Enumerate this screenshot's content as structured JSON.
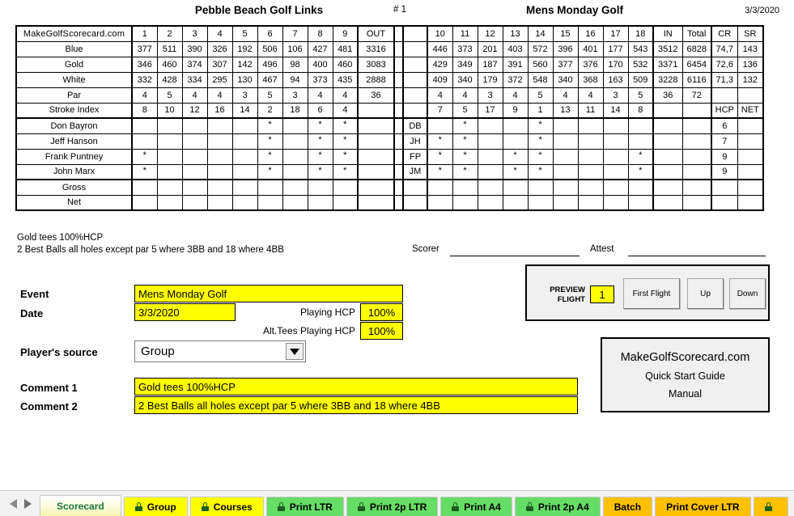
{
  "header": {
    "course": "Pebble Beach Golf Links",
    "card_number": "# 1",
    "event": "Mens Monday Golf",
    "date": "3/3/2020"
  },
  "scorecard": {
    "brand": "MakeGolfScorecard.com",
    "front_holes": [
      "1",
      "2",
      "3",
      "4",
      "5",
      "6",
      "7",
      "8",
      "9"
    ],
    "out_label": "OUT",
    "back_holes": [
      "10",
      "11",
      "12",
      "13",
      "14",
      "15",
      "16",
      "17",
      "18"
    ],
    "in_label": "IN",
    "total_label": "Total",
    "cr_label": "CR",
    "sr_label": "SR",
    "hcp_label": "HCP",
    "net_label": "NET",
    "tee_rows": [
      {
        "name": "Blue",
        "front": [
          "377",
          "511",
          "390",
          "326",
          "192",
          "506",
          "106",
          "427",
          "481"
        ],
        "out": "3316",
        "back": [
          "446",
          "373",
          "201",
          "403",
          "572",
          "396",
          "401",
          "177",
          "543"
        ],
        "in": "3512",
        "total": "6828",
        "cr": "74,7",
        "sr": "143",
        "highlight": false
      },
      {
        "name": "Gold",
        "front": [
          "346",
          "460",
          "374",
          "307",
          "142",
          "496",
          "98",
          "400",
          "460"
        ],
        "out": "3083",
        "back": [
          "429",
          "349",
          "187",
          "391",
          "560",
          "377",
          "376",
          "170",
          "532"
        ],
        "in": "3371",
        "total": "6454",
        "cr": "72,6",
        "sr": "136",
        "highlight": true
      },
      {
        "name": "White",
        "front": [
          "332",
          "428",
          "334",
          "295",
          "130",
          "467",
          "94",
          "373",
          "435"
        ],
        "out": "2888",
        "back": [
          "409",
          "340",
          "179",
          "372",
          "548",
          "340",
          "368",
          "163",
          "509"
        ],
        "in": "3228",
        "total": "6116",
        "cr": "71,3",
        "sr": "132",
        "highlight": false
      }
    ],
    "par_row": {
      "name": "Par",
      "front": [
        "4",
        "5",
        "4",
        "4",
        "3",
        "5",
        "3",
        "4",
        "4"
      ],
      "out": "36",
      "back": [
        "4",
        "4",
        "3",
        "4",
        "5",
        "4",
        "4",
        "3",
        "5"
      ],
      "in": "36",
      "total": "72",
      "cr": "",
      "sr": ""
    },
    "stroke_index_row": {
      "name": "Stroke Index",
      "front": [
        "8",
        "10",
        "12",
        "16",
        "14",
        "2",
        "18",
        "6",
        "4"
      ],
      "out": "",
      "back": [
        "7",
        "5",
        "17",
        "9",
        "1",
        "13",
        "11",
        "14",
        "8"
      ],
      "in": "",
      "total": "",
      "cr": "HCP",
      "sr": "NET"
    },
    "players": [
      {
        "name": "Don Bayron",
        "initials": "DB",
        "front_stars": [
          false,
          false,
          false,
          false,
          false,
          true,
          false,
          true,
          true
        ],
        "back_stars": [
          false,
          true,
          false,
          false,
          true,
          false,
          false,
          false,
          false
        ],
        "hcp": "6",
        "net": ""
      },
      {
        "name": "Jeff Hanson",
        "initials": "JH",
        "front_stars": [
          false,
          false,
          false,
          false,
          false,
          true,
          false,
          true,
          true
        ],
        "back_stars": [
          true,
          true,
          false,
          false,
          true,
          false,
          false,
          false,
          false
        ],
        "hcp": "7",
        "net": ""
      },
      {
        "name": "Frank Puntney",
        "initials": "FP",
        "front_stars": [
          true,
          false,
          false,
          false,
          false,
          true,
          false,
          true,
          true
        ],
        "back_stars": [
          true,
          true,
          false,
          true,
          true,
          false,
          false,
          false,
          true
        ],
        "hcp": "9",
        "net": ""
      },
      {
        "name": "John Marx",
        "initials": "JM",
        "front_stars": [
          true,
          false,
          false,
          false,
          false,
          true,
          false,
          true,
          true
        ],
        "back_stars": [
          true,
          true,
          false,
          true,
          true,
          false,
          false,
          false,
          true
        ],
        "hcp": "9",
        "net": ""
      }
    ],
    "summary_rows": [
      {
        "name": "Gross"
      },
      {
        "name": "Net"
      }
    ],
    "star_glyph": "*",
    "highlight_colors": {
      "cream": "#fdf0cd",
      "orange": "#fbcbac",
      "gold_row": "#f2f2f2"
    }
  },
  "notes": {
    "line1": "Gold tees 100%HCP",
    "line2": "2 Best Balls all holes except par 5 where 3BB and 18 where 4BB"
  },
  "signatures": {
    "scorer_label": "Scorer",
    "attest_label": "Attest"
  },
  "form": {
    "event_label": "Event",
    "event_value": "Mens Monday Golf",
    "date_label": "Date",
    "date_value": "3/3/2020",
    "playing_hcp_label": "Playing HCP",
    "playing_hcp_value": "100%",
    "alt_tees_hcp_label": "Alt.Tees Playing HCP",
    "alt_tees_hcp_value": "100%",
    "player_source_label": "Player's source",
    "player_source_value": "Group",
    "comment1_label": "Comment 1",
    "comment1_value": "Gold tees 100%HCP",
    "comment2_label": "Comment 2",
    "comment2_value": "2 Best Balls all holes except par 5 where 3BB and 18 where 4BB"
  },
  "preview_flight": {
    "label_line1": "PREVIEW",
    "label_line2": "FLIGHT",
    "number": "1",
    "buttons": [
      "First Flight",
      "Up",
      "Down"
    ]
  },
  "linkbox": {
    "site": "MakeGolfScorecard.com",
    "quick_start": "Quick Start Guide",
    "manual": "Manual"
  },
  "tabbar": {
    "tabs": [
      {
        "label": "Scorecard",
        "locked": false,
        "active": true,
        "color": "#fbfbdc"
      },
      {
        "label": "Group",
        "locked": true,
        "active": false,
        "color": "#ffff00"
      },
      {
        "label": "Courses",
        "locked": true,
        "active": false,
        "color": "#ffff00"
      },
      {
        "label": "Print LTR",
        "locked": true,
        "active": false,
        "color": "#66dd66"
      },
      {
        "label": "Print 2p LTR",
        "locked": true,
        "active": false,
        "color": "#66dd66"
      },
      {
        "label": "Print A4",
        "locked": true,
        "active": false,
        "color": "#66dd66"
      },
      {
        "label": "Print 2p A4",
        "locked": true,
        "active": false,
        "color": "#66dd66"
      },
      {
        "label": "Batch",
        "locked": false,
        "active": false,
        "color": "#ffc000"
      },
      {
        "label": "Print Cover LTR",
        "locked": false,
        "active": false,
        "color": "#ffc000"
      },
      {
        "label": "",
        "locked": true,
        "active": false,
        "color": "#ffc000"
      }
    ]
  }
}
